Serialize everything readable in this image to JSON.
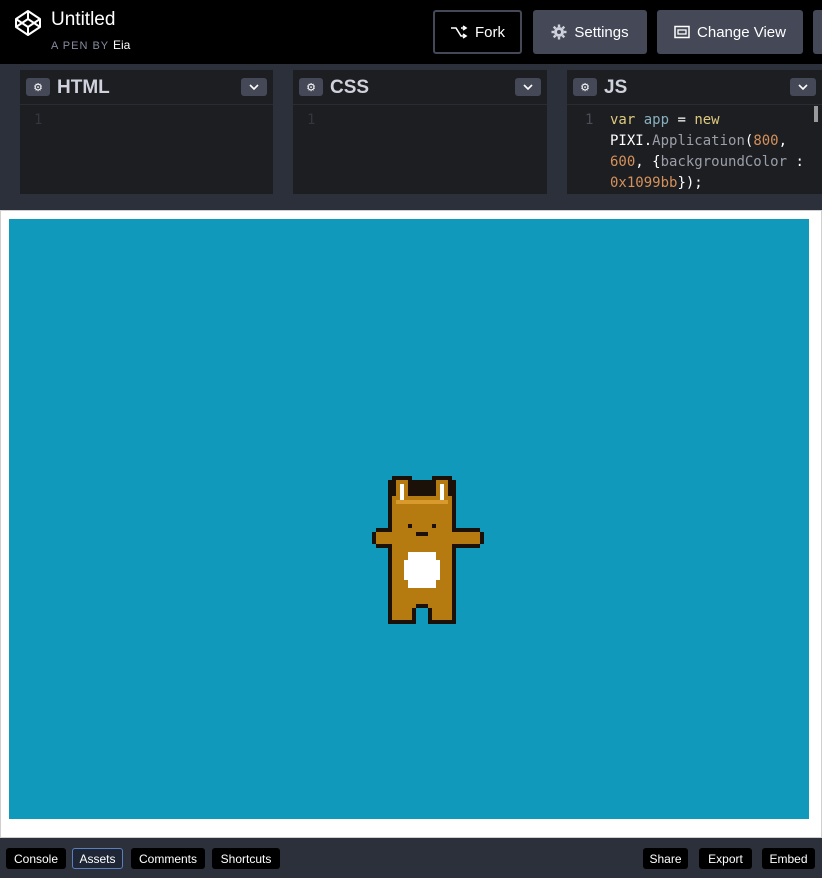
{
  "header": {
    "title": "Untitled",
    "byline_prefix": "A PEN BY",
    "author": "Eia",
    "buttons": {
      "fork": "Fork",
      "settings": "Settings",
      "change_view": "Change View"
    }
  },
  "editors": {
    "html": {
      "name": "HTML",
      "line_number": "1"
    },
    "css": {
      "name": "CSS",
      "line_number": "1"
    },
    "js": {
      "name": "JS",
      "line_number": "1",
      "code_lines": [
        [
          "var",
          " ",
          "app",
          " = ",
          "new"
        ],
        [
          "PIXI",
          ".",
          "Application",
          "(",
          "800",
          ","
        ],
        [
          "600",
          ", {",
          "backgroundColor",
          " :"
        ],
        [
          "0x1099bb",
          "});"
        ]
      ]
    }
  },
  "preview": {
    "background_color": "#1099bb",
    "sprite": "bunny"
  },
  "footer": {
    "left_buttons": [
      "Console",
      "Assets",
      "Comments",
      "Shortcuts"
    ],
    "right_buttons": [
      "Share",
      "Export",
      "Embed"
    ]
  },
  "colors": {
    "header_bg": "#000000",
    "button_bg": "#444857",
    "editor_bg": "#1d1e22",
    "stage_bg": "#1099bb"
  }
}
